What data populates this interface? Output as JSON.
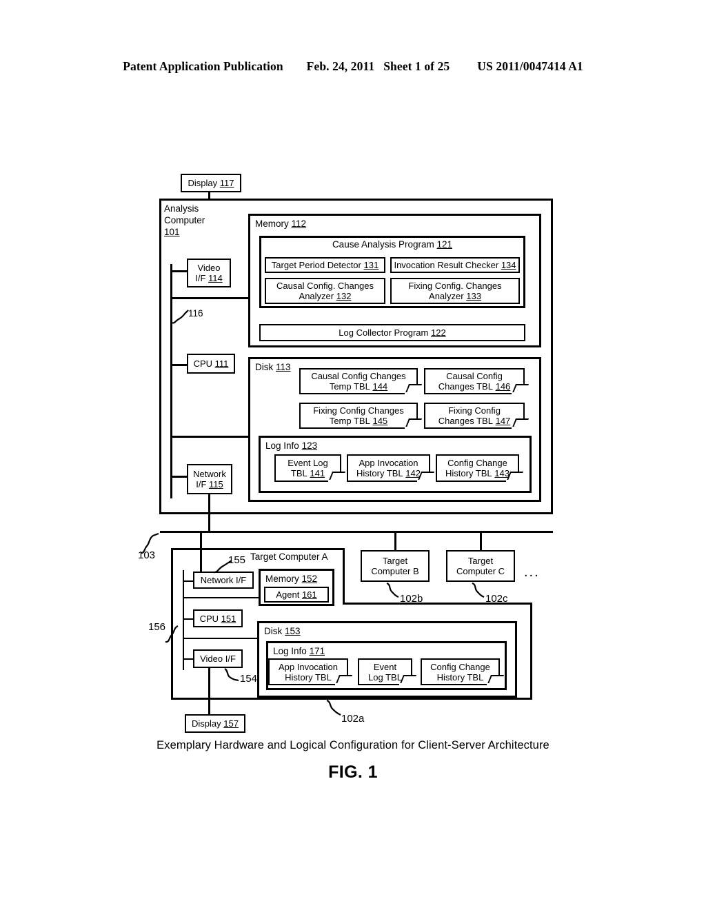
{
  "header": {
    "publication": "Patent Application Publication",
    "date": "Feb. 24, 2011",
    "sheet": "Sheet 1 of 25",
    "doc_number": "US 2011/0047414 A1"
  },
  "figure": {
    "caption": "Exemplary Hardware and Logical Configuration for Client-Server Architecture",
    "number": "FIG. 1",
    "ellipsis": "..."
  },
  "analysis_computer": {
    "title_line1": "Analysis",
    "title_line2": "Computer",
    "ref": "101",
    "display": {
      "label": "Display",
      "ref": "117"
    },
    "video_if": {
      "line1": "Video",
      "line2": "I/F",
      "ref": "114"
    },
    "cpu": {
      "label": "CPU",
      "ref": "111"
    },
    "network_if": {
      "line1": "Network",
      "line2": "I/F",
      "ref": "115"
    },
    "bus_ref": "116",
    "memory": {
      "label": "Memory",
      "ref": "112",
      "cause_analysis_program": {
        "label": "Cause Analysis Program",
        "ref": "121",
        "modules": [
          {
            "label": "Target Period Detector",
            "ref": "131"
          },
          {
            "label": "Invocation Result Checker",
            "ref": "134"
          },
          {
            "line1": "Causal Config. Changes",
            "line2": "Analyzer",
            "ref": "132"
          },
          {
            "line1": "Fixing Config. Changes",
            "line2": "Analyzer",
            "ref": "133"
          }
        ]
      },
      "log_collector_program": {
        "label": "Log Collector Program",
        "ref": "122"
      }
    },
    "disk": {
      "label": "Disk",
      "ref": "113",
      "tables": [
        {
          "line1": "Causal Config Changes",
          "line2": "Temp TBL",
          "ref": "144"
        },
        {
          "line1": "Causal Config",
          "line2": "Changes TBL",
          "ref": "146"
        },
        {
          "line1": "Fixing Config Changes",
          "line2": "Temp TBL",
          "ref": "145"
        },
        {
          "line1": "Fixing Config",
          "line2": "Changes TBL",
          "ref": "147"
        }
      ],
      "log_info": {
        "label": "Log Info",
        "ref": "123",
        "tables": [
          {
            "line1": "Event Log",
            "line2": "TBL",
            "ref": "141"
          },
          {
            "line1": "App Invocation",
            "line2": "History TBL",
            "ref": "142"
          },
          {
            "line1": "Config Change",
            "line2": "History TBL",
            "ref": "143"
          }
        ]
      }
    }
  },
  "network": {
    "ref": "103"
  },
  "target_computer_a": {
    "title": "Target Computer A",
    "ref": "102a",
    "network_if": {
      "label": "Network I/F",
      "ref": "155"
    },
    "cpu": {
      "label": "CPU",
      "ref": "151"
    },
    "video_if": {
      "label": "Video I/F",
      "ref": "154"
    },
    "bus_ref": "156",
    "display": {
      "label": "Display",
      "ref": "157"
    },
    "memory": {
      "label": "Memory",
      "ref": "152",
      "agent": {
        "label": "Agent",
        "ref": "161"
      }
    },
    "disk": {
      "label": "Disk",
      "ref": "153",
      "log_info": {
        "label": "Log Info",
        "ref": "171",
        "tables": [
          {
            "line1": "App Invocation",
            "line2": "History TBL"
          },
          {
            "line1": "Event",
            "line2": "Log TBL"
          },
          {
            "line1": "Config Change",
            "line2": "History TBL"
          }
        ]
      }
    }
  },
  "target_computer_b": {
    "line1": "Target",
    "line2": "Computer B",
    "ref": "102b"
  },
  "target_computer_c": {
    "line1": "Target",
    "line2": "Computer C",
    "ref": "102c"
  }
}
